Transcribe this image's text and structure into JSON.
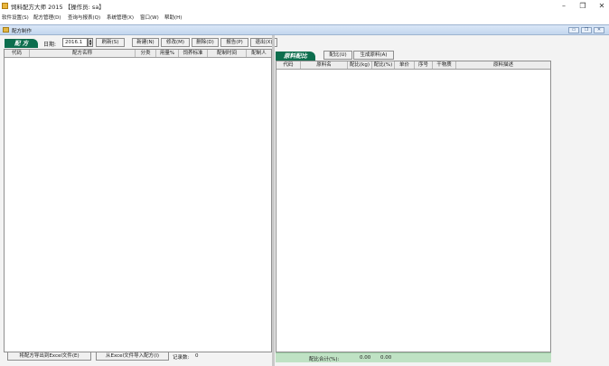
{
  "window": {
    "title": "饲料配方大师 2015  【操作员: sa】",
    "minimize": "–",
    "maximize": "❐",
    "close": "✕"
  },
  "menu": [
    "软件设置(S)",
    "配方管理(D)",
    "查询与报表(Q)",
    "系统管理(X)",
    "窗口(W)",
    "帮助(H)"
  ],
  "mdi": {
    "title": "配方制作",
    "buttons": [
      "▭",
      "❐",
      "✕"
    ]
  },
  "left": {
    "tab_label": "配 方",
    "date_label": "日期:",
    "date_value": "2016.1",
    "buttons": [
      "刷新(S)",
      "新建(N)",
      "修改(M)",
      "删除(D)",
      "报告(P)",
      "退出(X)"
    ],
    "columns": [
      "代码",
      "配方名称",
      "分类",
      "用量%",
      "饲养标准",
      "配制时间",
      "配制人"
    ],
    "export_button": "将配方导出到Excel文件(E)",
    "import_button": "从Excel文件导入配方(I)",
    "record_label": "记录数:",
    "record_count": "0"
  },
  "right": {
    "tab_label": "原料配比",
    "buttons": [
      "配比(U)",
      "生成原料(A)"
    ],
    "columns": [
      "代码",
      "原料名",
      "配比(kg)",
      "配比(%)",
      "单价",
      "序号",
      "干物质",
      "原料描述"
    ],
    "footer_label": "配比合计(%):",
    "footer_kg": "0.00",
    "footer_pct": "0.00"
  },
  "colors": {
    "tab_green": "#0d6e4e",
    "footer_green": "#bfe2c4"
  }
}
